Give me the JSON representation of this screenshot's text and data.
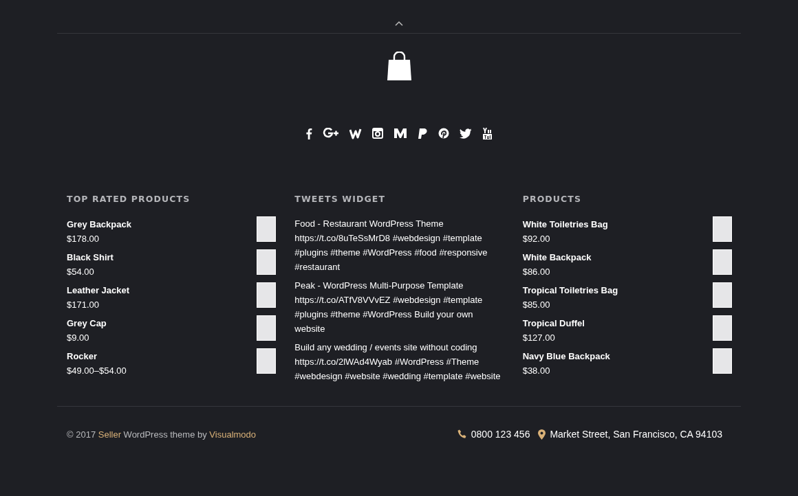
{
  "widgets": [
    {
      "kind": "products",
      "title": "TOP RATED PRODUCTS",
      "items": [
        {
          "name": "Grey Backpack",
          "price": "$178.00"
        },
        {
          "name": "Black Shirt",
          "price": "$54.00"
        },
        {
          "name": "Leather Jacket",
          "price": "$171.00"
        },
        {
          "name": "Grey Cap",
          "price": "$9.00"
        },
        {
          "name": "Rocker",
          "price": "$49.00–$54.00"
        }
      ]
    },
    {
      "kind": "tweets",
      "title": "TWEETS WIDGET",
      "items": [
        "Food - Restaurant WordPress Theme https://t.co/8uTeSsMrD8 #webdesign #template #plugins #theme #WordPress #food #responsive #restaurant",
        "Peak - WordPress Multi-Purpose Template https://t.co/ATfV8VVvEZ #webdesign #template #plugins #theme #WordPress Build your own website",
        "Build any wedding / events site without coding https://t.co/2lWAd4Wyab #WordPress #Theme #webdesign #website #wedding #template #website"
      ]
    },
    {
      "kind": "products",
      "title": "PRODUCTS",
      "items": [
        {
          "name": "White Toiletries Bag",
          "price": "$92.00"
        },
        {
          "name": "White Backpack",
          "price": "$86.00"
        },
        {
          "name": "Tropical Toiletries Bag",
          "price": "$85.00"
        },
        {
          "name": "Tropical Duffel",
          "price": "$127.00"
        },
        {
          "name": "Navy Blue Backpack",
          "price": "$38.00"
        }
      ]
    }
  ],
  "footer": {
    "year": "© 2017",
    "theme_link": "Seller",
    "middle": "WordPress theme by",
    "author_link": "Visualmodo",
    "phone": "0800 123 456",
    "address": "Market Street, San Francisco, CA 94103"
  }
}
